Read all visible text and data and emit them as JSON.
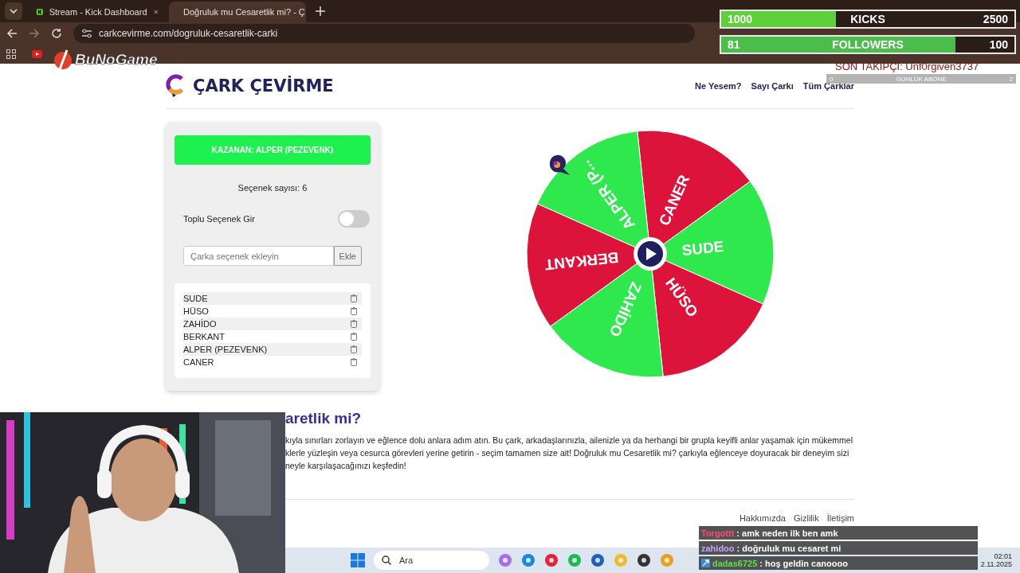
{
  "browser": {
    "tabs": [
      {
        "title": "Stream - Kick Dashboard",
        "selected": false
      },
      {
        "title": "Doğruluk mu Cesaretlik mi? - Ç",
        "selected": true
      }
    ],
    "url": "carkcevirme.com/dogruluk-cesaretlik-carki"
  },
  "overlay": {
    "logo": "BuNoGame",
    "goals": [
      {
        "current": "1000",
        "label": "KICKS",
        "target": "2500",
        "level": 0.39
      },
      {
        "current": "81",
        "label": "FOLLOWERS",
        "target": "100",
        "level": 0.8
      }
    ],
    "last_follower": "SON TAKİPÇİ: Unf0rgiven3737",
    "daily_subs": {
      "current": "0",
      "label": "GÜNLÜK ABONE",
      "target": "2"
    },
    "chat": [
      {
        "user": "Torgottt",
        "color": "#ff4a78",
        "message": ": amk neden ilk ben amk",
        "badge": false
      },
      {
        "user": "zahidoo",
        "color": "#c8a4f4",
        "message": ": doğruluk mu cesaret mi",
        "badge": false
      },
      {
        "user": "dadas6725",
        "color": "#5ee04a",
        "message": ": hoş geldin canoooo",
        "badge": true
      }
    ]
  },
  "site": {
    "logo": "ÇARK ÇEVİRME",
    "nav": [
      "Ne Yesem?",
      "Sayı Çarkı",
      "Tüm Çarklar"
    ],
    "winner": "KAZANAN: ALPER (PEZEVENK)",
    "count": "Seçenek sayısı: 6",
    "bulk": {
      "label": "Toplu Seçenek Gir",
      "on": false
    },
    "input": {
      "placeholder": "Çarka seçenek ekleyin",
      "button": "Ekle"
    },
    "options": [
      "SUDE",
      "HÜSO",
      "ZAHİDO",
      "BERKANT",
      "ALPER (PEZEVENK)",
      "CANER"
    ],
    "wheel": [
      {
        "label": "CANER",
        "color": "#dc143c"
      },
      {
        "label": "SUDE",
        "color": "#2ee84e"
      },
      {
        "label": "HÜSO",
        "color": "#dc143c"
      },
      {
        "label": "ZAHİDO",
        "color": "#2ee84e"
      },
      {
        "label": "BERKANT",
        "color": "#dc143c"
      },
      {
        "label": "ALPER (P...",
        "color": "#2ee84e"
      }
    ],
    "heading": "aretlik mi?",
    "paragraph": [
      "kıyla sınırları zorlayın ve eğlence dolu anlara adım atın. Bu çark, arkadaşlarınızla, ailenizle ya da herhangi bir grupla keyifli anlar yaşamak için mükemmel",
      "klerle yüzleşin veya cesurca görevleri yerine getirin - seçim tamamen size ait! Doğruluk mu Cesaretlik mi? çarkıyla eğlenceye doyuracak bir deneyim sizi",
      "neyle karşılaşacağınızı keşfedin!"
    ],
    "footer": [
      "Hakkımızda",
      "Gizlilik",
      "İletişim"
    ]
  },
  "taskbar": {
    "search": "Ara",
    "time": "02:01",
    "date": "2.11.2025"
  }
}
